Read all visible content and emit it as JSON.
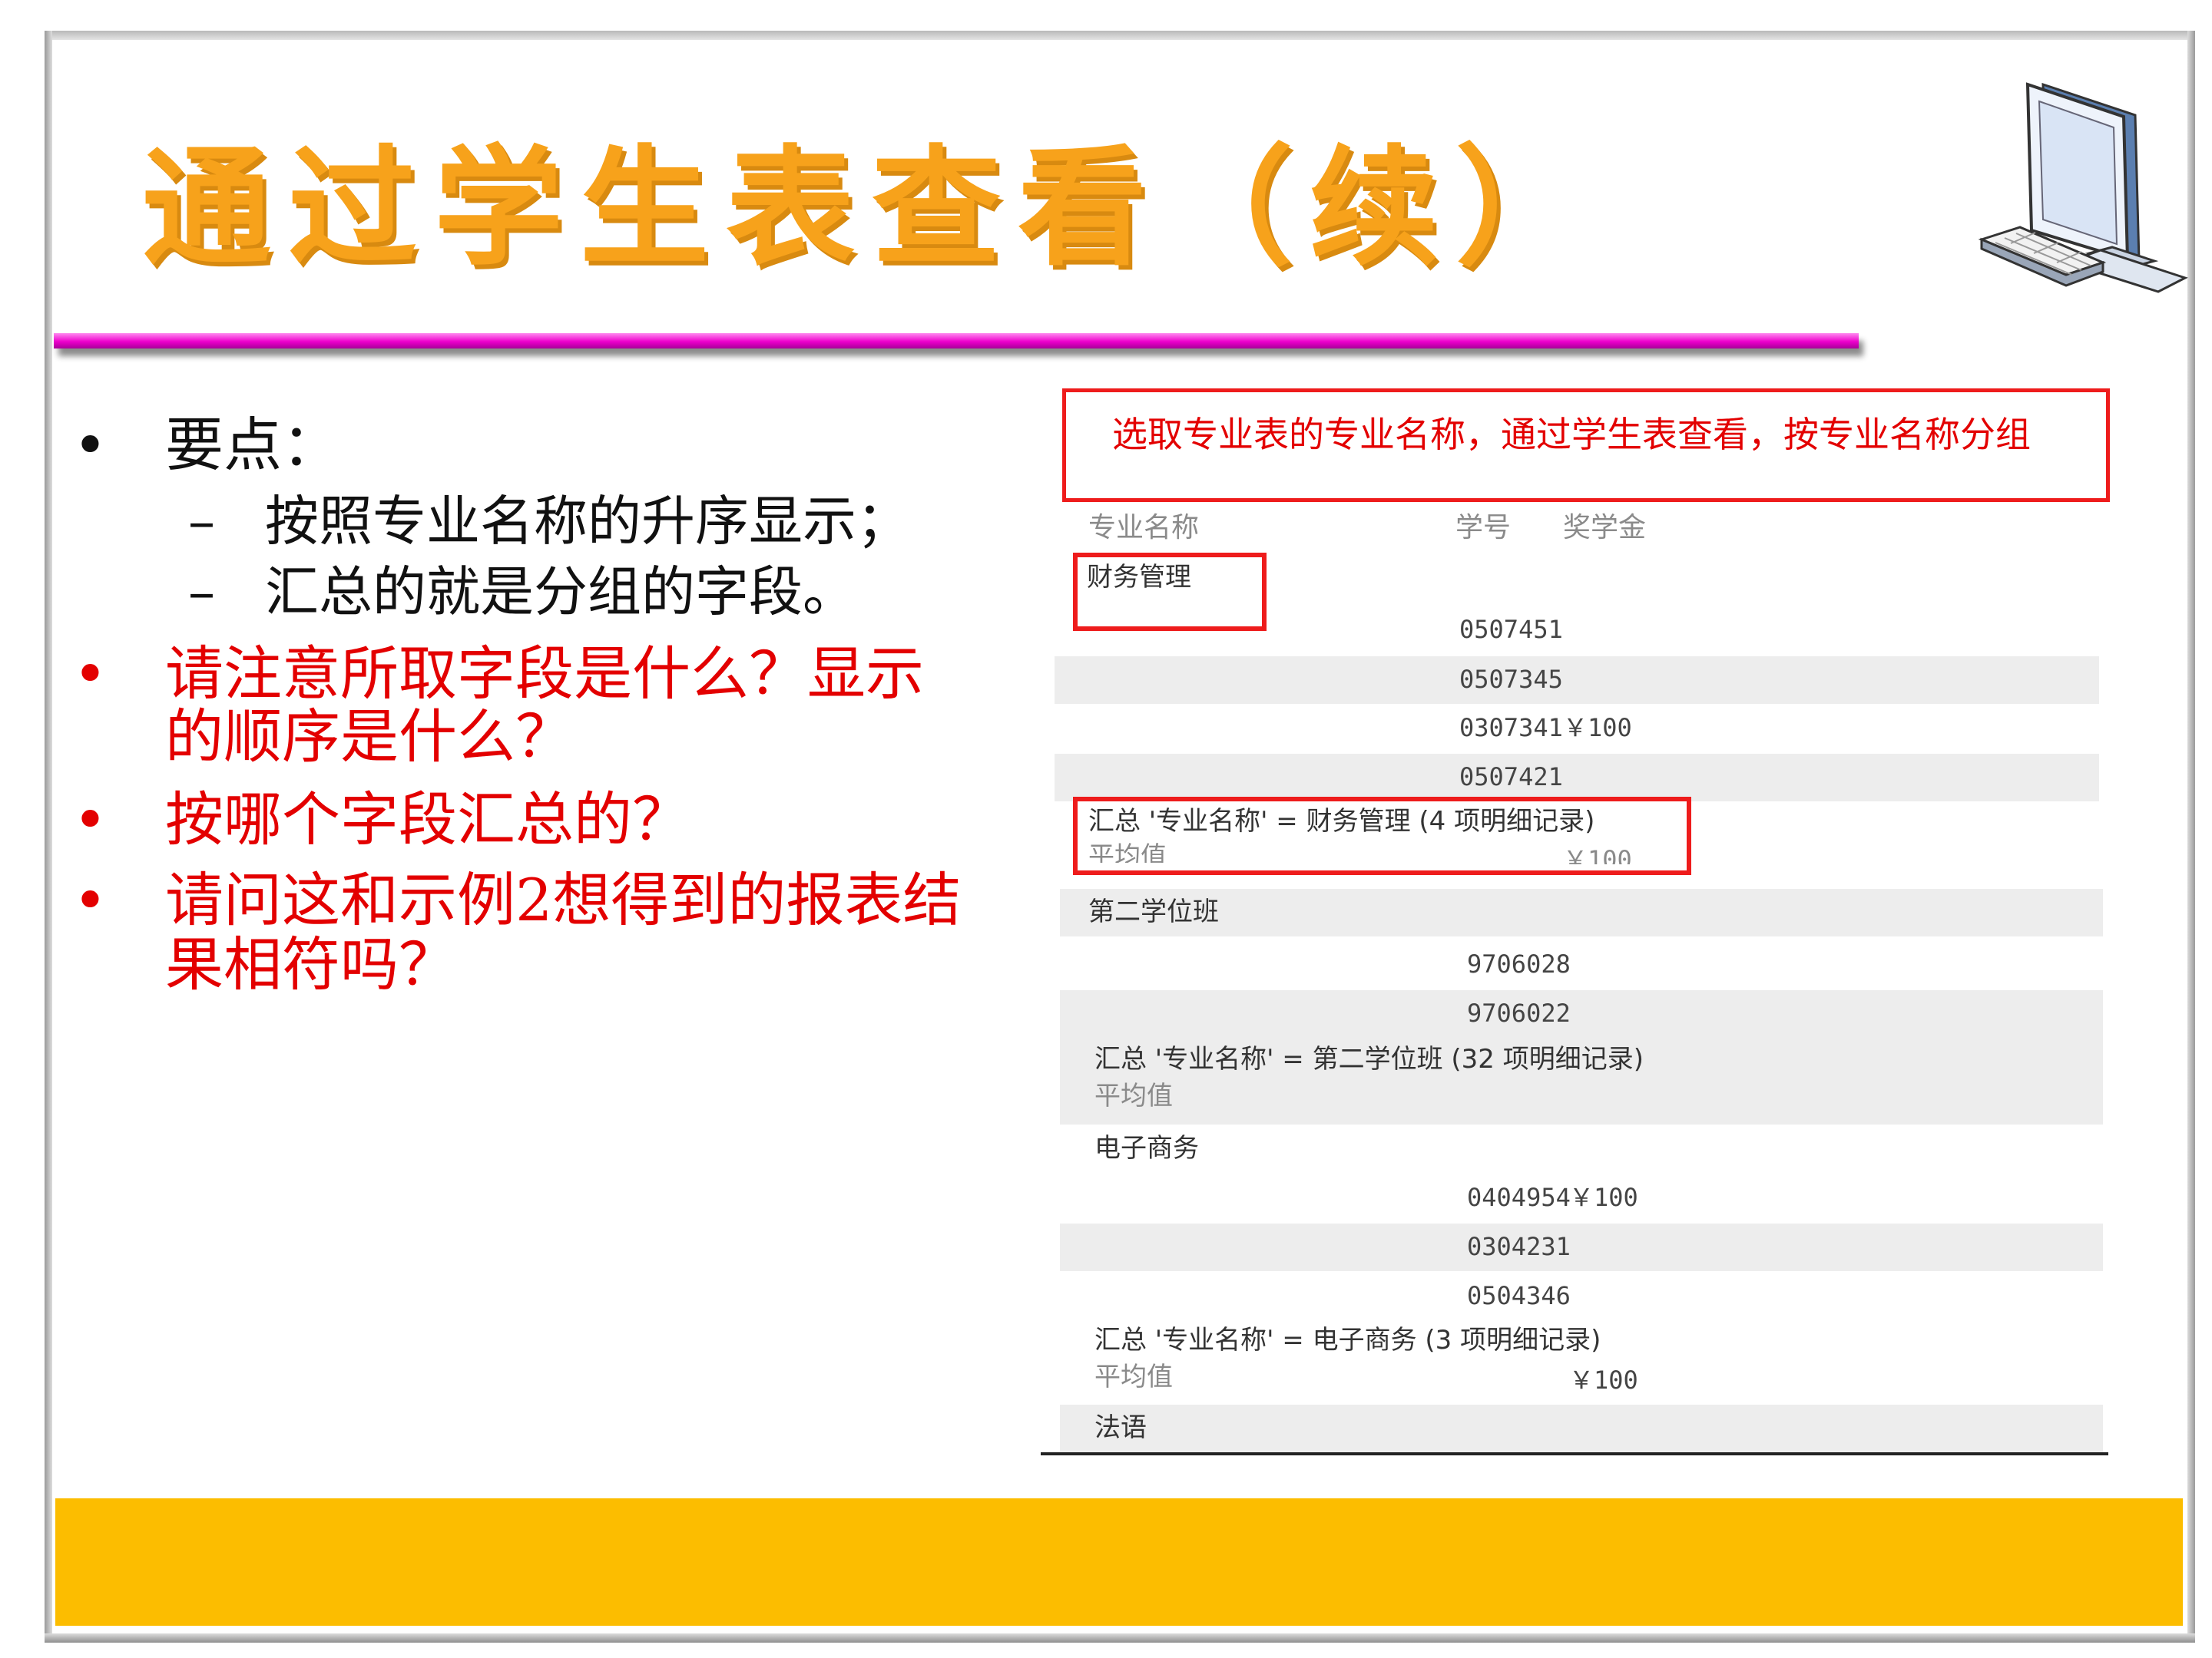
{
  "slide": {
    "title": "通过学生表查看（续）"
  },
  "bullets": {
    "b1": "要点：",
    "b1_sub1": "按照专业名称的升序显示；",
    "b1_sub2": "汇总的就是分组的字段。",
    "b2_line1": "请注意所取字段是什么？显示",
    "b2_line2": "的顺序是什么？",
    "b3": "按哪个字段汇总的？",
    "b4_line1": "请问这和示例2想得到的报表结",
    "b4_line2": "果相符吗？",
    "bullet_symbol": "•",
    "dash_symbol": "–"
  },
  "report": {
    "note": "选取专业表的专业名称，通过学生表查看，按专业名称分组",
    "headers": {
      "major": "专业名称",
      "student_id": "学号",
      "scholarship": "奖学金"
    },
    "groups": [
      {
        "name": "财务管理",
        "rows": [
          {
            "id": "0507451",
            "amount": ""
          },
          {
            "id": "0507345",
            "amount": ""
          },
          {
            "id": "0307341",
            "amount": "￥100"
          },
          {
            "id": "0507421",
            "amount": ""
          }
        ],
        "summary": "汇总 '专业名称' =  财务管理 (4 项明细记录)",
        "avg_label": "平均值",
        "avg_value": "￥100"
      },
      {
        "name": "第二学位班",
        "rows": [
          {
            "id": "9706028",
            "amount": ""
          },
          {
            "id": "9706022",
            "amount": ""
          }
        ],
        "summary": "汇总 '专业名称' =  第二学位班 (32 项明细记录)",
        "avg_label": "平均值",
        "avg_value": ""
      },
      {
        "name": "电子商务",
        "rows": [
          {
            "id": "0404954",
            "amount": "￥100"
          },
          {
            "id": "0304231",
            "amount": ""
          },
          {
            "id": "0504346",
            "amount": ""
          }
        ],
        "summary": "汇总 '专业名称' =  电子商务 (3 项明细记录)",
        "avg_label": "平均值",
        "avg_value": "￥100"
      },
      {
        "name": "法语",
        "rows": []
      }
    ]
  },
  "colors": {
    "title": "#f7a21b",
    "rule": "#ee00cc",
    "red": "#e30000",
    "bar": "#fcbd00"
  },
  "icons": {
    "computer": "computer-icon"
  }
}
